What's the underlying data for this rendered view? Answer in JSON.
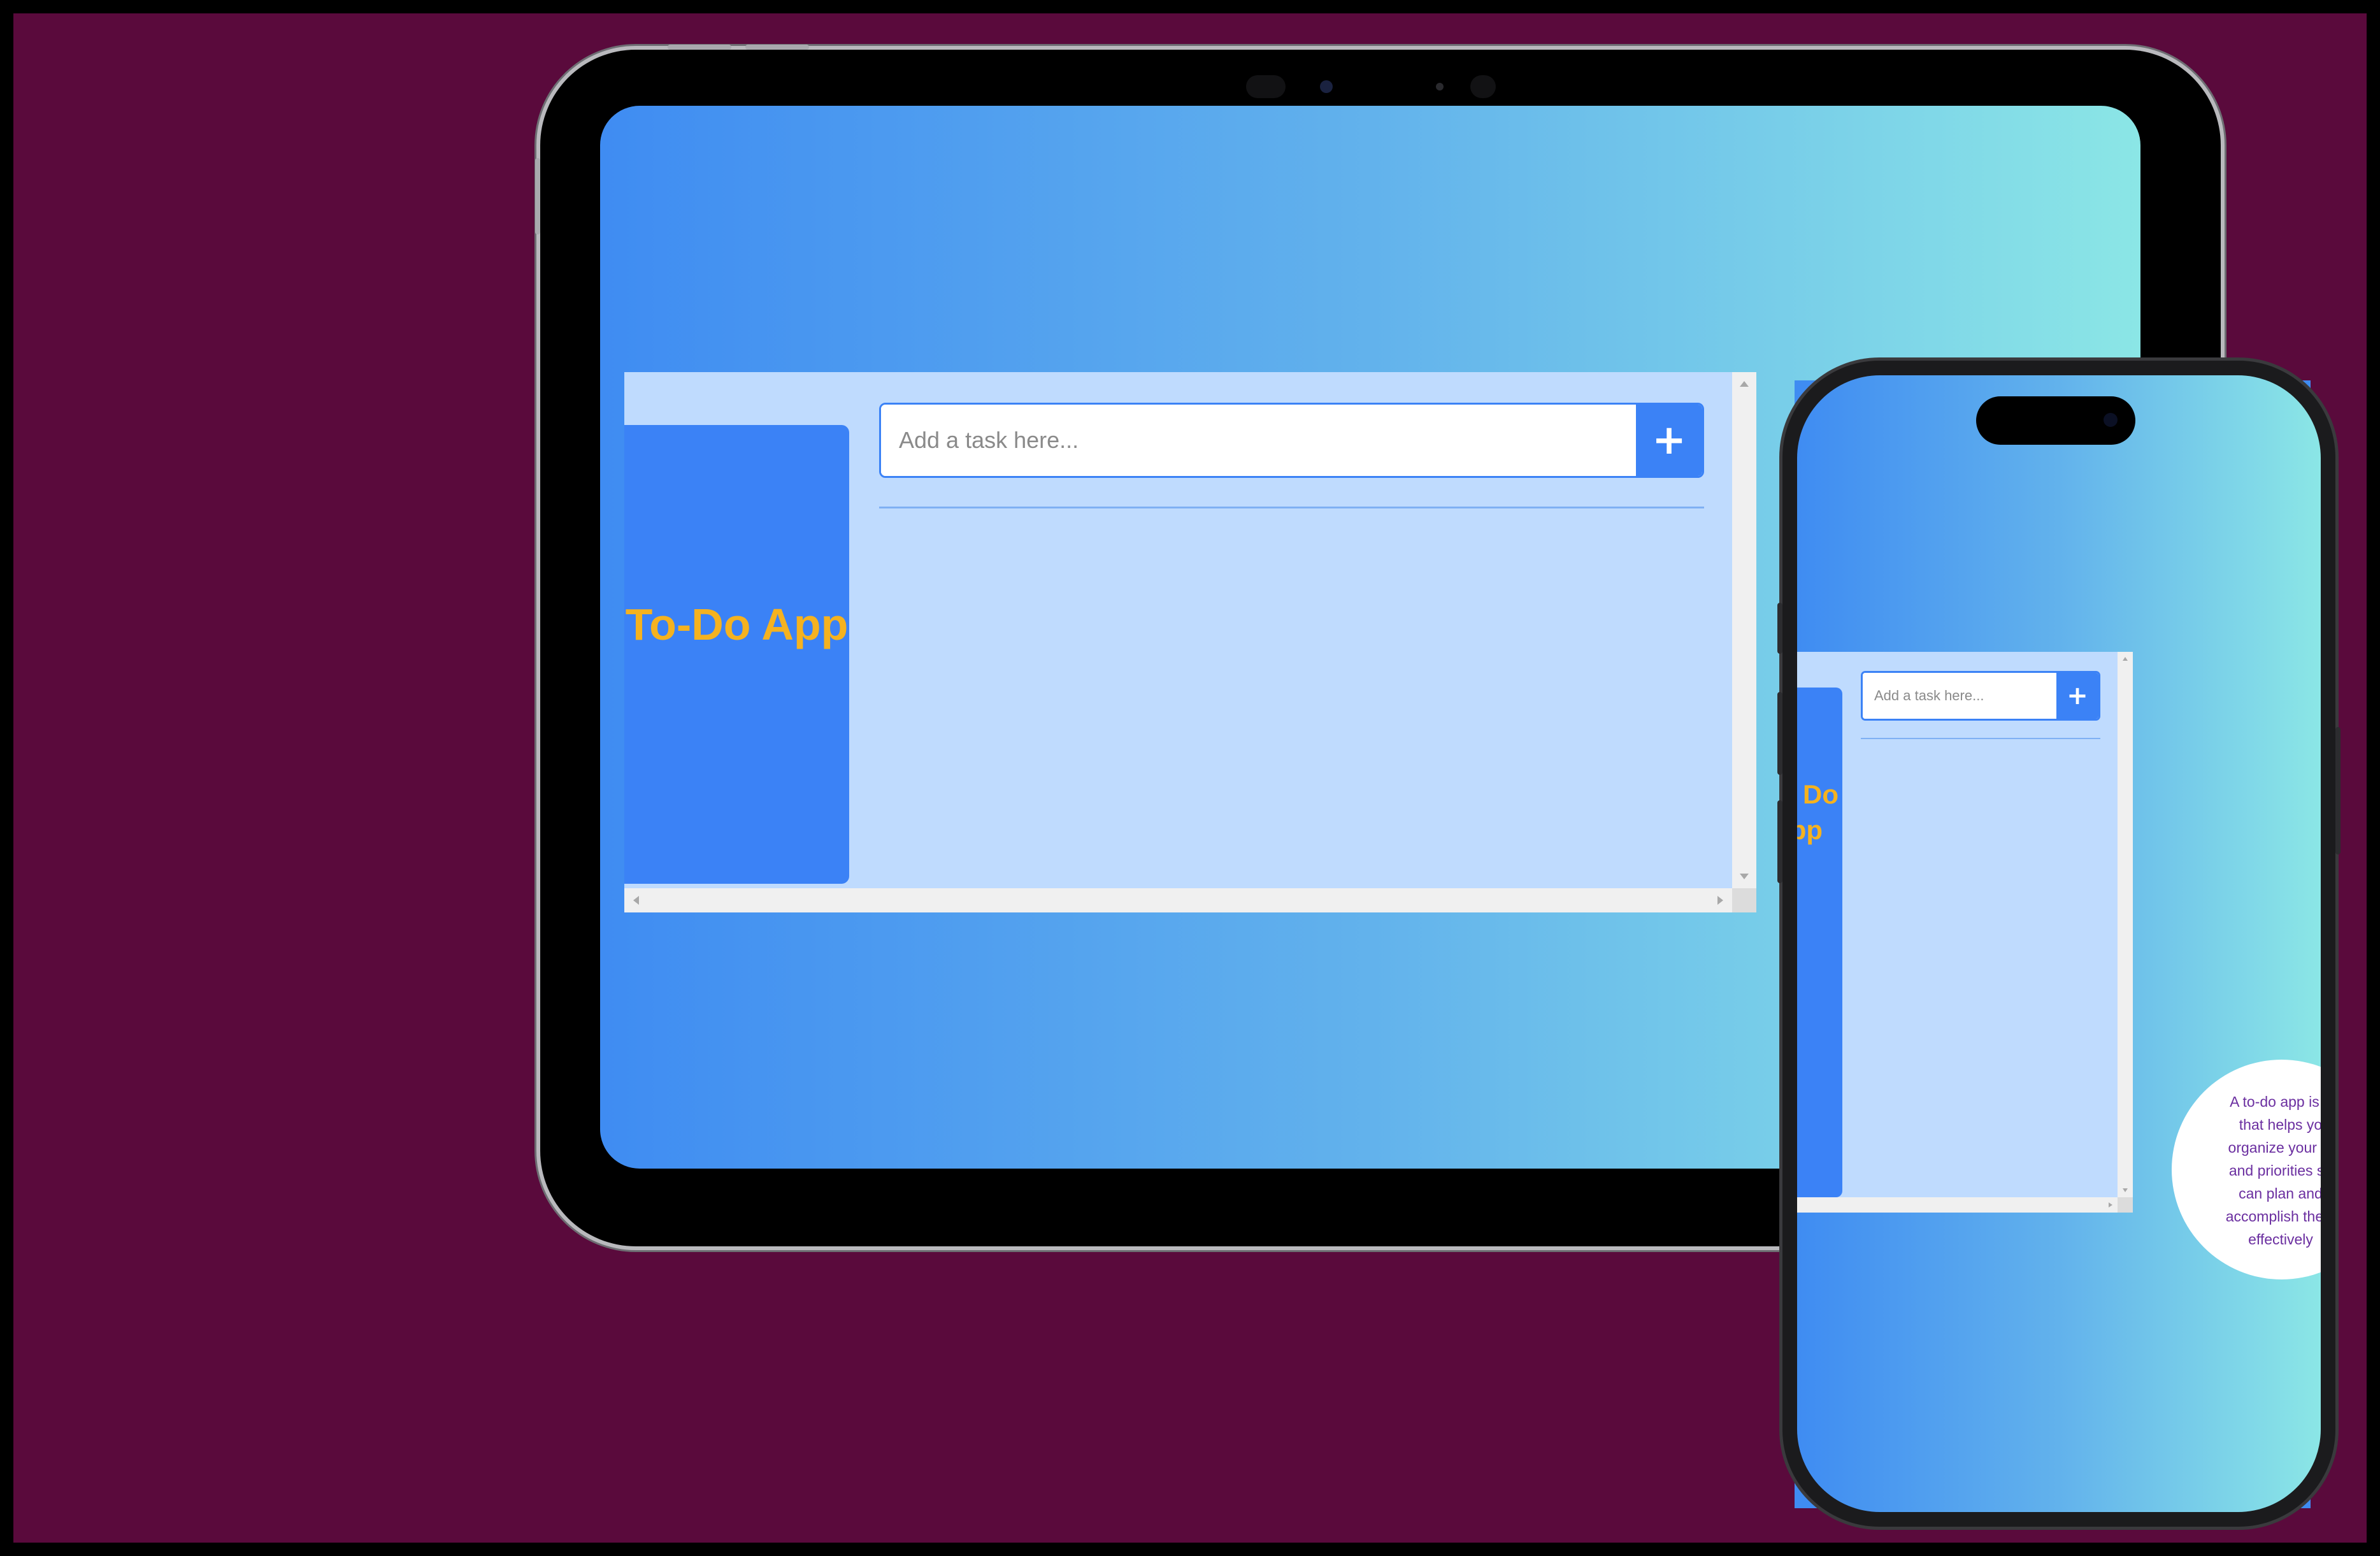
{
  "scene": {
    "background_color": "#5a0a3c",
    "accent_color": "#3b82f6",
    "title_color": "#f5b21f"
  },
  "tablet": {
    "app_title": "To-Do App",
    "task_input_placeholder": "Add a task here...",
    "add_button_label": "+"
  },
  "phone": {
    "app_title_visible": "Do\npp",
    "task_input_placeholder": "Add a task here...",
    "add_button_label": "+",
    "info_bubble_text": "A to-do app is a\nthat helps yo\norganize your ta\nand priorities so\ncan plan and\naccomplish them\neffectively"
  }
}
